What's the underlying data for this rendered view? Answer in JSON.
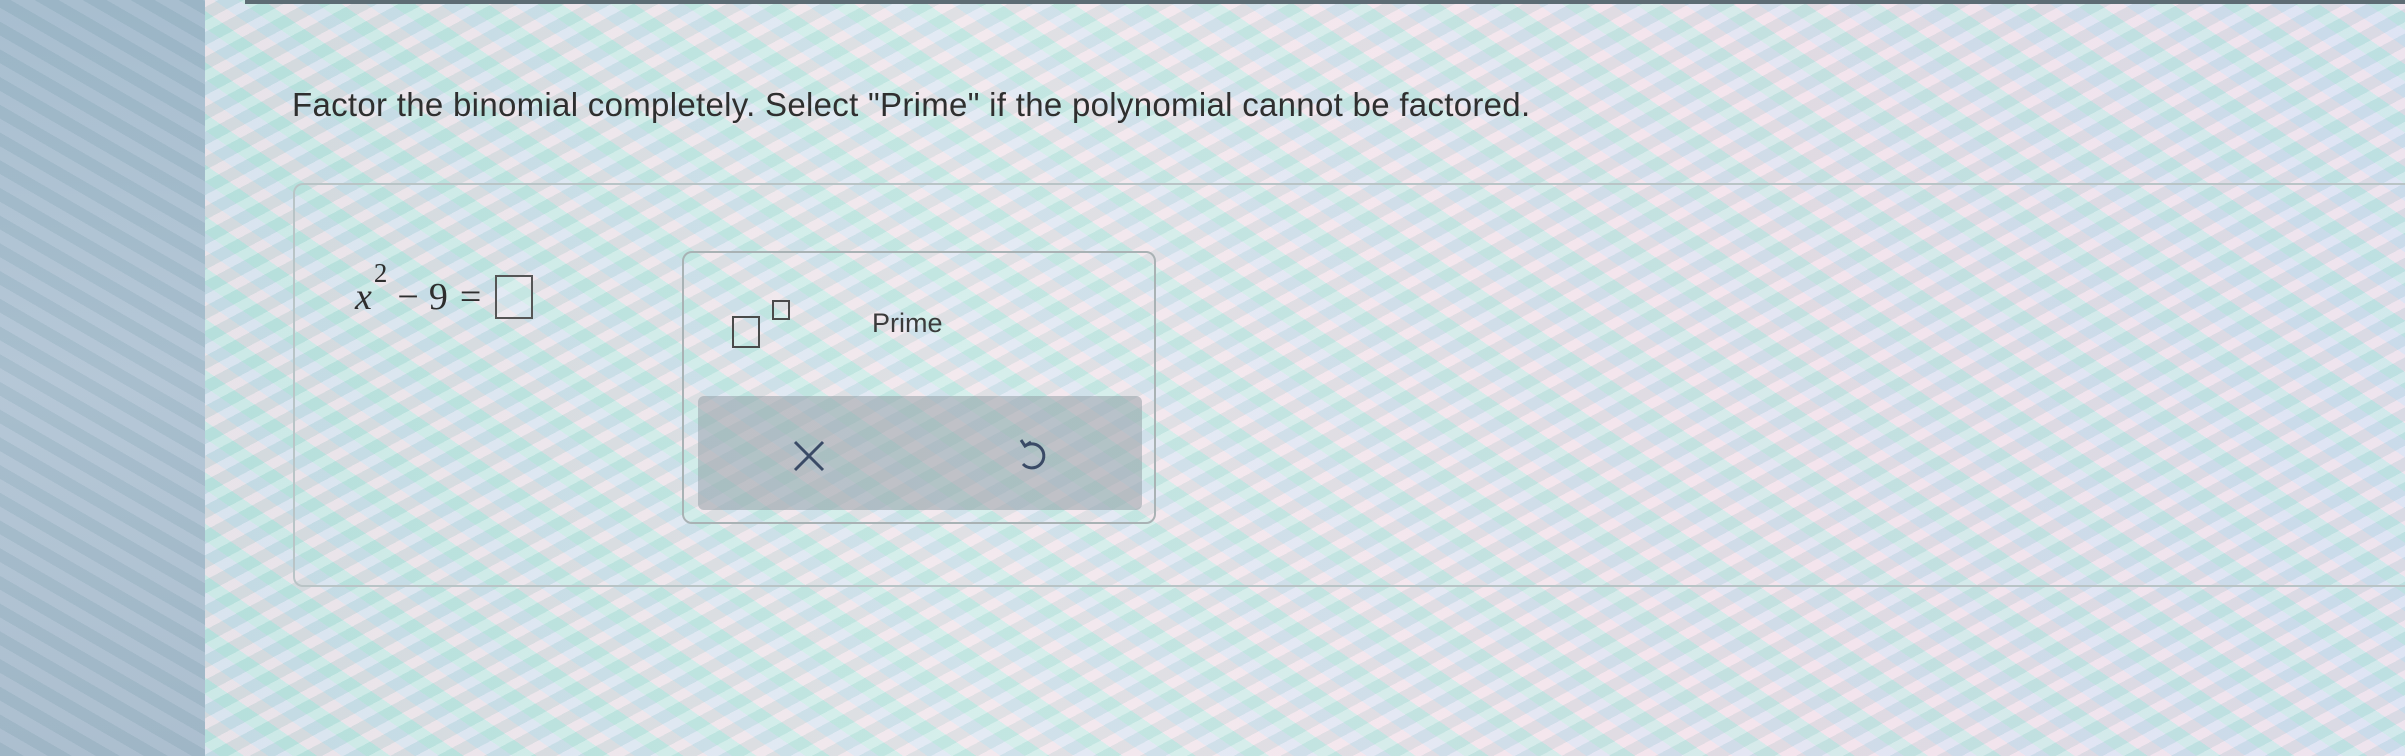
{
  "question": {
    "instruction": "Factor the binomial completely. Select \"Prime\" if the polynomial cannot be factored."
  },
  "equation": {
    "variable": "x",
    "exponent": "2",
    "operator": "−",
    "constant": "9",
    "equals": "="
  },
  "toolbar": {
    "exponent_button_icon": "exponent-template-icon",
    "prime_label": "Prime",
    "clear_icon": "close-x-icon",
    "undo_icon": "undo-icon"
  },
  "colors": {
    "text": "#2f2f2f",
    "panel_border": "#b9c4c6",
    "action_bar": "#969fa8"
  }
}
